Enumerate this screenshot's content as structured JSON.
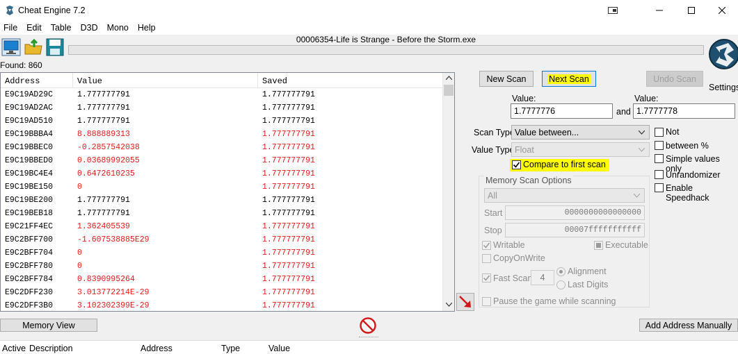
{
  "window": {
    "title": "Cheat Engine 7.2"
  },
  "menu": [
    "File",
    "Edit",
    "Table",
    "D3D",
    "Mono",
    "Help"
  ],
  "process": "00006354-Life is Strange - Before the Storm.exe",
  "found_label": "Found: 860",
  "results": {
    "columns": [
      "Address",
      "Value",
      "Saved"
    ],
    "rows": [
      {
        "address": "E9C19AD29C",
        "value": "1.777777791",
        "saved": "1.777777791",
        "changed": false
      },
      {
        "address": "E9C19AD2AC",
        "value": "1.777777791",
        "saved": "1.777777791",
        "changed": false
      },
      {
        "address": "E9C19AD510",
        "value": "1.777777791",
        "saved": "1.777777791",
        "changed": false
      },
      {
        "address": "E9C19BBBA4",
        "value": "8.888889313",
        "saved": "1.777777791",
        "changed": true
      },
      {
        "address": "E9C19BBEC0",
        "value": "-0.2857542038",
        "saved": "1.777777791",
        "changed": true
      },
      {
        "address": "E9C19BBED0",
        "value": "0.03689992055",
        "saved": "1.777777791",
        "changed": true
      },
      {
        "address": "E9C19BC4E4",
        "value": "0.6472610235",
        "saved": "1.777777791",
        "changed": true
      },
      {
        "address": "E9C19BE150",
        "value": "0",
        "saved": "1.777777791",
        "changed": true
      },
      {
        "address": "E9C19BE200",
        "value": "1.777777791",
        "saved": "1.777777791",
        "changed": false
      },
      {
        "address": "E9C19BEB18",
        "value": "1.777777791",
        "saved": "1.777777791",
        "changed": false
      },
      {
        "address": "E9C21FF4EC",
        "value": "1.362405539",
        "saved": "1.777777791",
        "changed": true
      },
      {
        "address": "E9C2BFF700",
        "value": "-1.607538885E29",
        "saved": "1.777777791",
        "changed": true
      },
      {
        "address": "E9C2BFF704",
        "value": "0",
        "saved": "1.777777791",
        "changed": true
      },
      {
        "address": "E9C2BFF780",
        "value": "0",
        "saved": "1.777777791",
        "changed": true
      },
      {
        "address": "E9C2BFF784",
        "value": "0.8390995264",
        "saved": "1.777777791",
        "changed": true
      },
      {
        "address": "E9C2DFF230",
        "value": "3.013772214E-29",
        "saved": "1.777777791",
        "changed": true
      },
      {
        "address": "E9C2DFF3B0",
        "value": "3.102302399E-29",
        "saved": "1.777777791",
        "changed": true
      }
    ]
  },
  "buttons": {
    "new_scan": "New Scan",
    "next_scan": "Next Scan",
    "undo_scan": "Undo Scan",
    "settings": "Settings",
    "memory_view": "Memory View",
    "add_address": "Add Address Manually"
  },
  "scan": {
    "value_label_1": "Value:",
    "value_1": "1.7777776",
    "and_label": "and",
    "value_label_2": "Value:",
    "value_2": "1.7777778",
    "scan_type_label": "Scan Type",
    "scan_type": "Value between...",
    "value_type_label": "Value Type",
    "value_type": "Float",
    "compare_first": "Compare to first scan",
    "not": "Not",
    "between_pct": "between %",
    "simple_values": "Simple values only",
    "unrandomizer": "Unrandomizer",
    "speedhack": "Enable Speedhack"
  },
  "memory_options": {
    "title": "Memory Scan Options",
    "region": "All",
    "start_label": "Start",
    "start": "0000000000000000",
    "stop_label": "Stop",
    "stop": "00007fffffffffff",
    "writable": "Writable",
    "executable": "Executable",
    "copy_on_write": "CopyOnWrite",
    "fast_scan": "Fast Scan",
    "fast_scan_value": "4",
    "alignment": "Alignment",
    "last_digits": "Last Digits",
    "pause_game": "Pause the game while scanning"
  },
  "address_list": {
    "columns": [
      "Active",
      "Description",
      "Address",
      "Type",
      "Value"
    ]
  },
  "colors": {
    "changed": "#e31c1c",
    "highlight": "#ffff00"
  }
}
